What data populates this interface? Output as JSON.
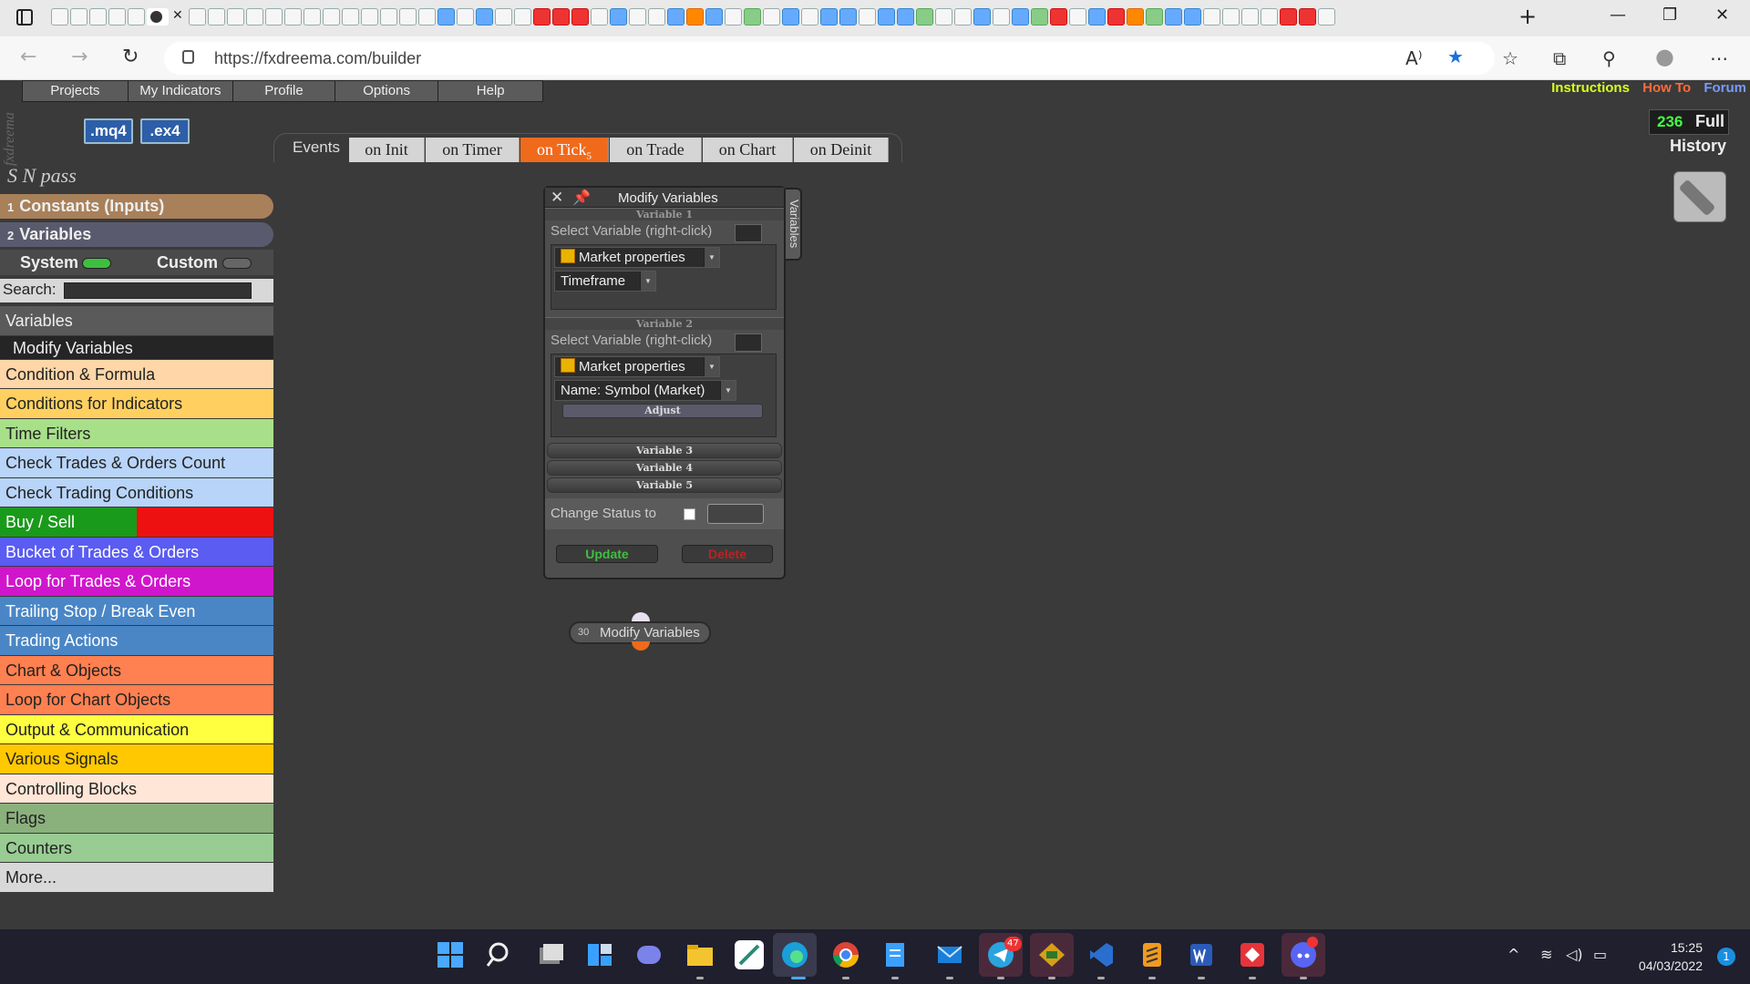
{
  "browser": {
    "url": "https://fxdreema.com/builder",
    "new_tab": "+",
    "minimize": "—",
    "restore": "❐",
    "close": "✕",
    "back": "←",
    "forward": "→",
    "refresh": "↻",
    "read_aloud": "A⁾",
    "favorite": "★",
    "favorites": "☆",
    "collections": "⧉",
    "extensions": "⚲",
    "profile": "●",
    "more": "⋯"
  },
  "app": {
    "logo_text": "fxdreema",
    "menu": [
      "Projects",
      "My Indicators",
      "Profile",
      "Options",
      "Help"
    ],
    "mq4": ".mq4",
    "ex4": ".ex4",
    "links": {
      "instructions": "Instructions",
      "howto": "How To",
      "forum": "Forum"
    },
    "counter": "236",
    "plan": "Full",
    "history": "History",
    "project_name": "S N pass",
    "events_label": "Events",
    "events": [
      "on Init",
      "on Timer",
      "on Tick",
      "on Trade",
      "on Chart",
      "on Deinit"
    ],
    "active_event_count": "5",
    "constants": {
      "num": "1",
      "label": "Constants (Inputs)"
    },
    "variables": {
      "num": "2",
      "label": "Variables"
    },
    "system_label": "System",
    "custom_label": "Custom",
    "search_label": "Search:",
    "categories_header": "Variables",
    "categories_sub": "Modify Variables",
    "categories": [
      {
        "label": "Condition & Formula",
        "color": "#ffd6a8",
        "text": "#222"
      },
      {
        "label": "Conditions for Indicators",
        "color": "#ffd060",
        "text": "#222"
      },
      {
        "label": "Time Filters",
        "color": "#a8e08a",
        "text": "#222"
      },
      {
        "label": "Check Trades & Orders Count",
        "color": "#b8d4f8",
        "text": "#222"
      },
      {
        "label": "Check Trading Conditions",
        "color": "#b8d4f8",
        "text": "#222"
      },
      {
        "label": "Buy / Sell",
        "color": "#1a9a1a",
        "text": "#fff"
      },
      {
        "label": "Bucket of Trades & Orders",
        "color": "#5a5cf2",
        "text": "#fff"
      },
      {
        "label": "Loop for Trades & Orders",
        "color": "#d016cc",
        "text": "#fff"
      },
      {
        "label": "Trailing Stop / Break Even",
        "color": "#4a86c6",
        "text": "#fff"
      },
      {
        "label": "Trading Actions",
        "color": "#4a86c6",
        "text": "#fff"
      },
      {
        "label": "Chart & Objects",
        "color": "#ff8050",
        "text": "#222"
      },
      {
        "label": "Loop for Chart Objects",
        "color": "#ff8050",
        "text": "#222"
      },
      {
        "label": "Output & Communication",
        "color": "#ffff40",
        "text": "#222"
      },
      {
        "label": "Various Signals",
        "color": "#ffc800",
        "text": "#222"
      },
      {
        "label": "Controlling Blocks",
        "color": "#ffe6d6",
        "text": "#222"
      },
      {
        "label": "Flags",
        "color": "#8ab07c",
        "text": "#222"
      },
      {
        "label": "Counters",
        "color": "#98cc92",
        "text": "#222"
      },
      {
        "label": "More...",
        "color": "#d8d8d8",
        "text": "#222"
      }
    ]
  },
  "dialog": {
    "close": "✕",
    "pin": "📌",
    "title": "Modify Variables",
    "side_tab": "Variables",
    "var1_header": "Variable 1",
    "var2_header": "Variable 2",
    "var3": "Variable 3",
    "var4": "Variable 4",
    "var5": "Variable 5",
    "select_label": "Select Variable (right-click)",
    "v1_source": "Market properties",
    "v1_field": "Timeframe",
    "v2_source": "Market properties",
    "v2_field": "Name: Symbol (Market)",
    "adjust": "Adjust",
    "change_status": "Change Status to",
    "update": "Update",
    "delete": "Delete"
  },
  "block": {
    "num": "30",
    "label": "Modify Variables"
  },
  "taskbar": {
    "time": "15:25",
    "date": "04/03/2022",
    "notif": "1",
    "telegram_badge": "47",
    "tray_up": "^",
    "wifi": "≋",
    "volume": "◁)",
    "battery": "▭"
  }
}
